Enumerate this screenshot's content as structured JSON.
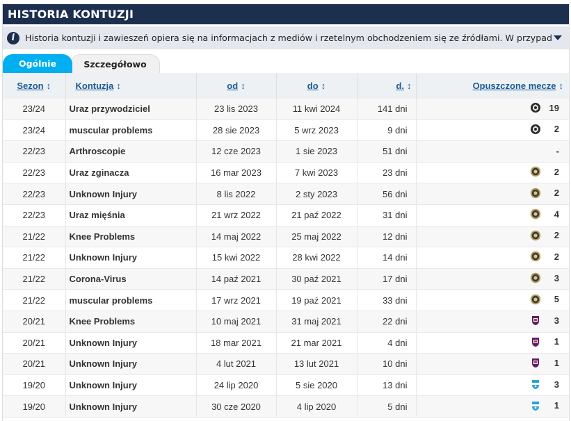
{
  "header": {
    "title": "HISTORIA KONTUZJI"
  },
  "info": {
    "text": "Historia kontuzji i zawieszeń opiera się na informacjach z mediów i rzetelnym obchodzeniem się ze źródłami. W przypadku wystąpienia błędów ...",
    "icon": "info-icon",
    "toggle_icon": "caret-down-icon"
  },
  "tabs": {
    "general": "Ogólnie",
    "detailed": "Szczegółowo"
  },
  "table": {
    "columns": {
      "season": "Sezon",
      "injury": "Kontuzja",
      "from": "od",
      "to": "do",
      "days": "d.",
      "missed": "Opuszczone mecze"
    },
    "sort_icon": "sort-arrows-icon",
    "rows": [
      {
        "season": "23/24",
        "injury": "Uraz przywodziciel",
        "from": "23 lis 2023",
        "to": "11 kwi 2024",
        "days": "141 dni",
        "club_icon": "club-crest-dark-icon",
        "missed": "19"
      },
      {
        "season": "23/24",
        "injury": "muscular problems",
        "from": "28 sie 2023",
        "to": "5 wrz 2023",
        "days": "9 dni",
        "club_icon": "club-crest-dark-icon",
        "missed": "2"
      },
      {
        "season": "22/23",
        "injury": "Arthroscopie",
        "from": "12 cze 2023",
        "to": "1 sie 2023",
        "days": "51 dni",
        "club_icon": "",
        "missed": "-"
      },
      {
        "season": "22/23",
        "injury": "Uraz zginacza",
        "from": "16 mar 2023",
        "to": "7 kwi 2023",
        "days": "23 dni",
        "club_icon": "club-crest-gold-icon",
        "missed": "2"
      },
      {
        "season": "22/23",
        "injury": "Unknown Injury",
        "from": "8 lis 2022",
        "to": "2 sty 2023",
        "days": "56 dni",
        "club_icon": "club-crest-gold-icon",
        "missed": "2"
      },
      {
        "season": "22/23",
        "injury": "Uraz mięśnia",
        "from": "21 wrz 2022",
        "to": "21 paź 2022",
        "days": "31 dni",
        "club_icon": "club-crest-gold-icon",
        "missed": "4"
      },
      {
        "season": "21/22",
        "injury": "Knee Problems",
        "from": "14 maj 2022",
        "to": "25 maj 2022",
        "days": "12 dni",
        "club_icon": "club-crest-gold-icon",
        "missed": "2"
      },
      {
        "season": "21/22",
        "injury": "Unknown Injury",
        "from": "15 kwi 2022",
        "to": "28 kwi 2022",
        "days": "14 dni",
        "club_icon": "club-crest-gold-icon",
        "missed": "2"
      },
      {
        "season": "21/22",
        "injury": "Corona-Virus",
        "from": "14 paź 2021",
        "to": "30 paź 2021",
        "days": "17 dni",
        "club_icon": "club-crest-gold-icon",
        "missed": "3"
      },
      {
        "season": "21/22",
        "injury": "muscular problems",
        "from": "17 wrz 2021",
        "to": "19 paź 2021",
        "days": "33 dni",
        "club_icon": "club-crest-gold-icon",
        "missed": "5"
      },
      {
        "season": "20/21",
        "injury": "Knee Problems",
        "from": "10 maj 2021",
        "to": "31 maj 2021",
        "days": "22 dni",
        "club_icon": "club-crest-purple-icon",
        "missed": "3"
      },
      {
        "season": "20/21",
        "injury": "Unknown Injury",
        "from": "18 mar 2021",
        "to": "21 mar 2021",
        "days": "4 dni",
        "club_icon": "club-crest-purple-icon",
        "missed": "1"
      },
      {
        "season": "20/21",
        "injury": "Unknown Injury",
        "from": "4 lut 2021",
        "to": "13 lut 2021",
        "days": "10 dni",
        "club_icon": "club-crest-purple-icon",
        "missed": "1"
      },
      {
        "season": "19/20",
        "injury": "Unknown Injury",
        "from": "24 lip 2020",
        "to": "5 sie 2020",
        "days": "13 dni",
        "club_icon": "club-crest-blue-icon",
        "missed": "3"
      },
      {
        "season": "19/20",
        "injury": "Unknown Injury",
        "from": "30 cze 2020",
        "to": "4 lip 2020",
        "days": "5 dni",
        "club_icon": "club-crest-blue-icon",
        "missed": "1"
      }
    ]
  },
  "colors": {
    "header_bg": "#1d2f4f",
    "info_bg": "#e4e8ee",
    "tab_active": "#00aff0",
    "link": "#1a5a96"
  }
}
